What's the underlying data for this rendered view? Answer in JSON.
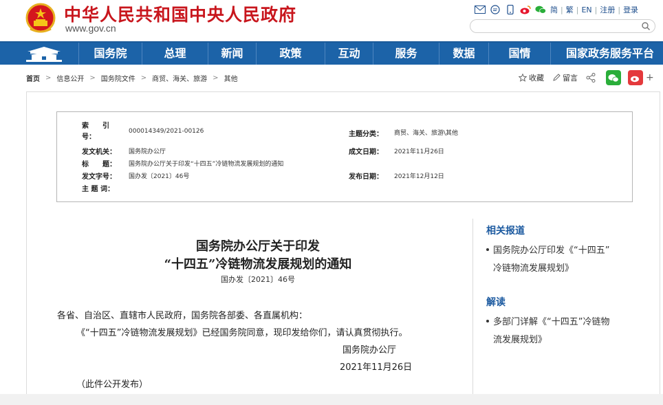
{
  "header": {
    "site_title": "中华人民共和国中央人民政府",
    "site_url": "www.gov.cn",
    "toplinks": [
      "简",
      "繁",
      "EN",
      "注册",
      "登录"
    ]
  },
  "nav": {
    "items": [
      "国务院",
      "总理",
      "新闻",
      "政策",
      "互动",
      "服务",
      "数据",
      "国情",
      "国家政务服务平台"
    ]
  },
  "breadcrumb": [
    "首页",
    "信息公开",
    "国务院文件",
    "商贸、海关、旅游",
    "其他"
  ],
  "tools": {
    "favorite": "收藏",
    "comment": "留言"
  },
  "meta": {
    "index_label": "索　　引　　号：",
    "index_value": "000014349/2021-00126",
    "category_label": "主题分类：",
    "category_value": "商贸、海关、旅游\\其他",
    "issuer_label": "发文机关：",
    "issuer_value": "国务院办公厅",
    "created_label": "成文日期：",
    "created_value": "2021年11月26日",
    "title_label": "标　　题：",
    "title_value": "国务院办公厅关于印发“十四五”冷链物流发展规划的通知",
    "docno_label": "发文字号：",
    "docno_value": "国办发〔2021〕46号",
    "published_label": "发布日期：",
    "published_value": "2021年12月12日",
    "keywords_label": "主  题  词："
  },
  "document": {
    "title_line1": "国务院办公厅关于印发",
    "title_line2": "“十四五”冷链物流发展规划的通知",
    "doc_number": "国办发〔2021〕46号",
    "salutation": "各省、自治区、直辖市人民政府，国务院各部委、各直属机构：",
    "body": "《“十四五”冷链物流发展规划》已经国务院同意，现印发给你们，请认真贯彻执行。",
    "signature": "国务院办公厅",
    "date": "2021年11月26日",
    "note": "（此件公开发布）"
  },
  "sidebar": {
    "related_heading": "相关报道",
    "related_items": [
      {
        "line1": "国务院办公厅印发《“十四五”",
        "line2": "冷链物流发展规划》"
      }
    ],
    "interpret_heading": "解读",
    "interpret_items": [
      {
        "line1": "多部门详解《“十四五”冷链物",
        "line2": "流发展规划》"
      }
    ]
  },
  "colors": {
    "brand_red": "#c8161d",
    "nav_blue": "#1c63a8",
    "link_blue": "#1c5aa0"
  }
}
